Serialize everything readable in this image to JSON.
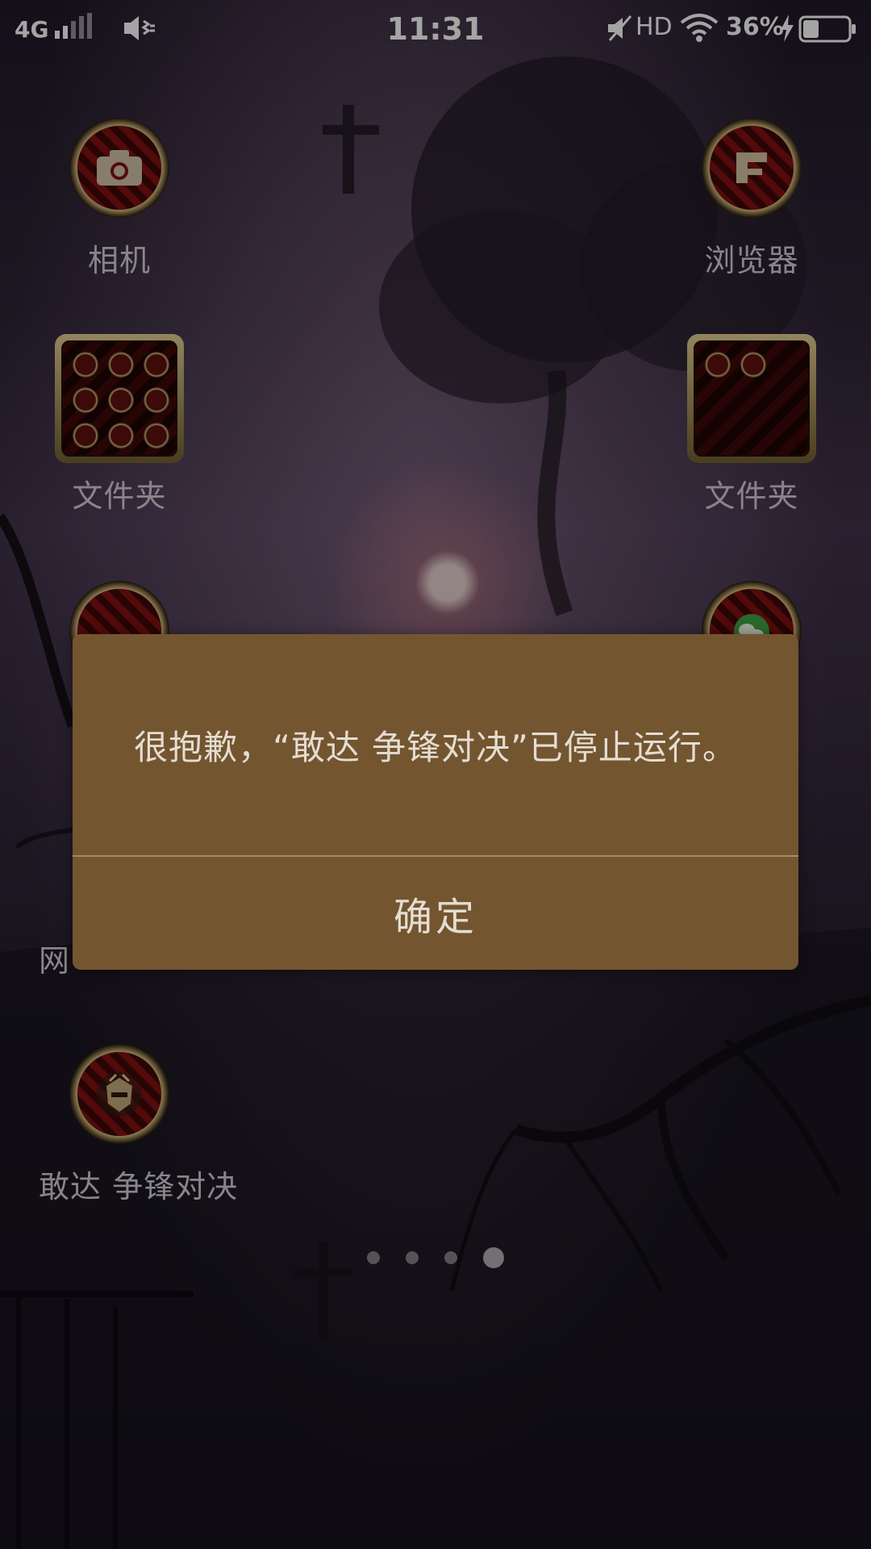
{
  "status_bar": {
    "network": "4G",
    "time": "11:31",
    "hd": "HD",
    "battery_percent": "36%",
    "battery_level": 0.36,
    "icons": [
      "signal-icon",
      "vibrate-icon",
      "mute-icon",
      "wifi-icon",
      "charging-icon",
      "battery-icon"
    ]
  },
  "apps": [
    {
      "label": "相机",
      "icon": "camera-icon"
    },
    {
      "label": "浏览器",
      "icon": "browser-icon"
    },
    {
      "label": "文件夹",
      "icon": "folder-icon"
    },
    {
      "label": "文件夹",
      "icon": "folder-icon"
    },
    {
      "label": "网",
      "icon": "app-icon"
    },
    {
      "label": "敢达 争锋对决",
      "icon": "gundam-app-icon"
    }
  ],
  "page_indicator": {
    "count": 4,
    "active_index": 3
  },
  "dialog": {
    "message": "很抱歉，“敢达 争锋对决”已停止运行。",
    "ok_label": "确定"
  },
  "colors": {
    "dialog_bg": "#735530",
    "icon_red": "#7a1010",
    "icon_gold": "#c9b27a"
  }
}
